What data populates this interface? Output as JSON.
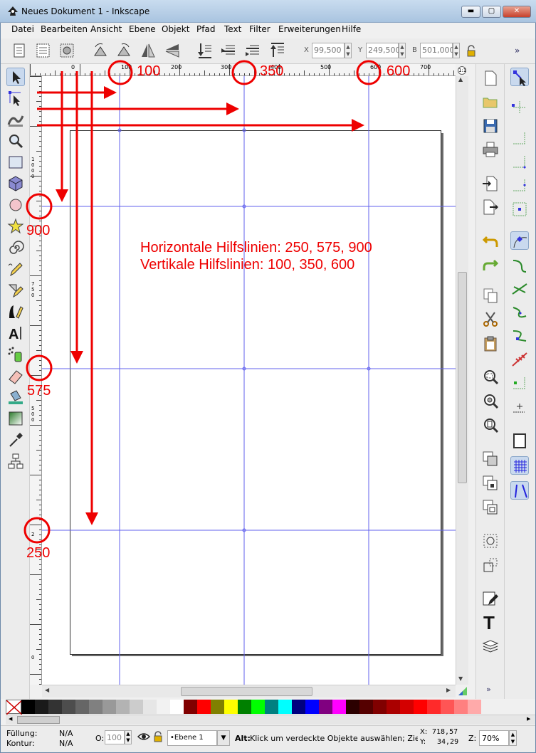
{
  "window": {
    "title": "Neues Dokument 1 - Inkscape"
  },
  "menubar": {
    "items": [
      "Datei",
      "Bearbeiten",
      "Ansicht",
      "Ebene",
      "Objekt",
      "Pfad",
      "Text",
      "Filter",
      "Erweiterungen",
      "Hilfe"
    ]
  },
  "toolbar": {
    "x_label": "X",
    "x_value": "99,500",
    "y_label": "Y",
    "y_value": "249,500",
    "w_label": "B",
    "w_value": "501,000",
    "more": "»"
  },
  "ruler_h": {
    "ticks": [
      "0",
      "100",
      "200",
      "300",
      "400",
      "500",
      "600",
      "700"
    ]
  },
  "ruler_v": {
    "ticks": [
      "1000",
      "750",
      "500",
      "2",
      "0"
    ]
  },
  "annotations": {
    "text_line1": "Horizontale Hilfslinien: 250, 575, 900",
    "text_line2": "Vertikale Hilfslinien: 100, 350, 600",
    "top_labels": [
      "100",
      "350",
      "600"
    ],
    "left_labels": [
      "900",
      "575",
      "250"
    ],
    "color": "#ee0000"
  },
  "guides": {
    "horizontal": [
      250,
      575,
      900
    ],
    "vertical": [
      100,
      350,
      600
    ],
    "color": "#6060ee"
  },
  "palette": {
    "colors": [
      "#000000",
      "#1a1a1a",
      "#333333",
      "#4d4d4d",
      "#666666",
      "#808080",
      "#999999",
      "#b3b3b3",
      "#cccccc",
      "#e6e6e6",
      "#f2f2f2",
      "#ffffff",
      "#800000",
      "#ff0000",
      "#808000",
      "#ffff00",
      "#008000",
      "#00ff00",
      "#008080",
      "#00ffff",
      "#000080",
      "#0000ff",
      "#800080",
      "#ff00ff",
      "#2b0000",
      "#550000",
      "#800000",
      "#aa0000",
      "#d40000",
      "#ff0000",
      "#ff2a2a",
      "#ff5555",
      "#ff8080",
      "#ffaaaa"
    ]
  },
  "status": {
    "fill_label": "Füllung:",
    "fill_value": "N/A",
    "stroke_label": "Kontur:",
    "stroke_value": "N/A",
    "opacity_label": "O:",
    "opacity_value": "100",
    "layer": "•Ebene 1",
    "message_bold": "Alt:",
    "message": "Klick um verdeckte Objekte auswählen; Zieh...",
    "x_label": "X:",
    "x_value": "718,57",
    "y_label": "Y:",
    "y_value": "34,29",
    "zoom_label": "Z:",
    "zoom_value": "70%"
  }
}
